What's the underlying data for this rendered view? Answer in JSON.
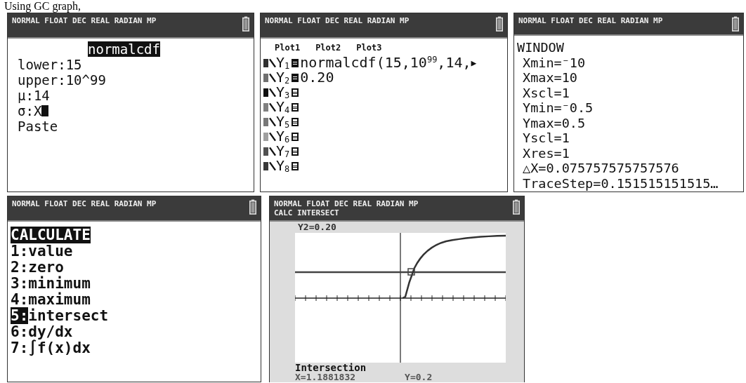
{
  "caption": "Using GC graph,",
  "screens": [
    {
      "kind": "form",
      "status": "NORMAL FLOAT DEC REAL RADIAN MP",
      "title": "normalcdf",
      "lines": [
        {
          "text": "lower:15",
          "cursor": false
        },
        {
          "text": "upper:10^99",
          "cursor": false
        },
        {
          "text": "μ:14",
          "cursor": false
        },
        {
          "text": "σ:X",
          "cursor": true
        },
        {
          "text": "Paste",
          "cursor": false
        }
      ]
    },
    {
      "kind": "y_editor",
      "status": "NORMAL FLOAT DEC REAL RADIAN MP",
      "plots": [
        "Plot1",
        "Plot2",
        "Plot3"
      ],
      "equations": [
        {
          "label": "Y$_{1}$",
          "expr": "normalcdf(15,10$^{99}$,14,",
          "more": "▶",
          "enabled": true,
          "color": "#303030"
        },
        {
          "label": "Y$_{2}$",
          "expr": "0.20",
          "enabled": true,
          "color": "#707070"
        },
        {
          "label": "Y$_{3}$",
          "enabled": false,
          "color": "#101010"
        },
        {
          "label": "Y$_{4}$",
          "enabled": false,
          "color": "#808080"
        },
        {
          "label": "Y$_{5}$",
          "enabled": false,
          "color": "#787878"
        },
        {
          "label": "Y$_{6}$",
          "enabled": false,
          "color": "#a0a0a0"
        },
        {
          "label": "Y$_{7}$",
          "enabled": false,
          "color": "#505050"
        },
        {
          "label": "Y$_{8}$",
          "enabled": false,
          "color": "#383838"
        }
      ]
    },
    {
      "kind": "window",
      "status": "NORMAL FLOAT DEC REAL RADIAN MP",
      "title": "WINDOW",
      "lines": [
        "Xmin=⁻10",
        "Xmax=10",
        "Xscl=1",
        "Ymin=⁻0.5",
        "Ymax=0.5",
        "Yscl=1",
        "Xres=1",
        "△X=0.075757575757576",
        "TraceStep=0.151515151515…"
      ]
    },
    {
      "kind": "menu",
      "status": "NORMAL FLOAT DEC REAL RADIAN MP",
      "title": "CALCULATE",
      "items": [
        {
          "number": "1:",
          "label": "value",
          "selected": false
        },
        {
          "number": "2:",
          "label": "zero",
          "selected": false
        },
        {
          "number": "3:",
          "label": "minimum",
          "selected": false
        },
        {
          "number": "4:",
          "label": "maximum",
          "selected": false
        },
        {
          "number": "5:",
          "label": "intersect",
          "selected": true
        },
        {
          "number": "6:",
          "label": "dy/dx",
          "selected": false
        },
        {
          "number": "7:",
          "label": "∫f(x)dx",
          "selected": false
        }
      ]
    },
    {
      "kind": "graph",
      "status": "NORMAL FLOAT DEC REAL RADIAN MP",
      "mode": "CALC INTERSECT",
      "function_label": "Y2=0.20",
      "result_title": "Intersection",
      "x_value": "X=1.1881832",
      "y_value": "Y=0.2"
    }
  ]
}
